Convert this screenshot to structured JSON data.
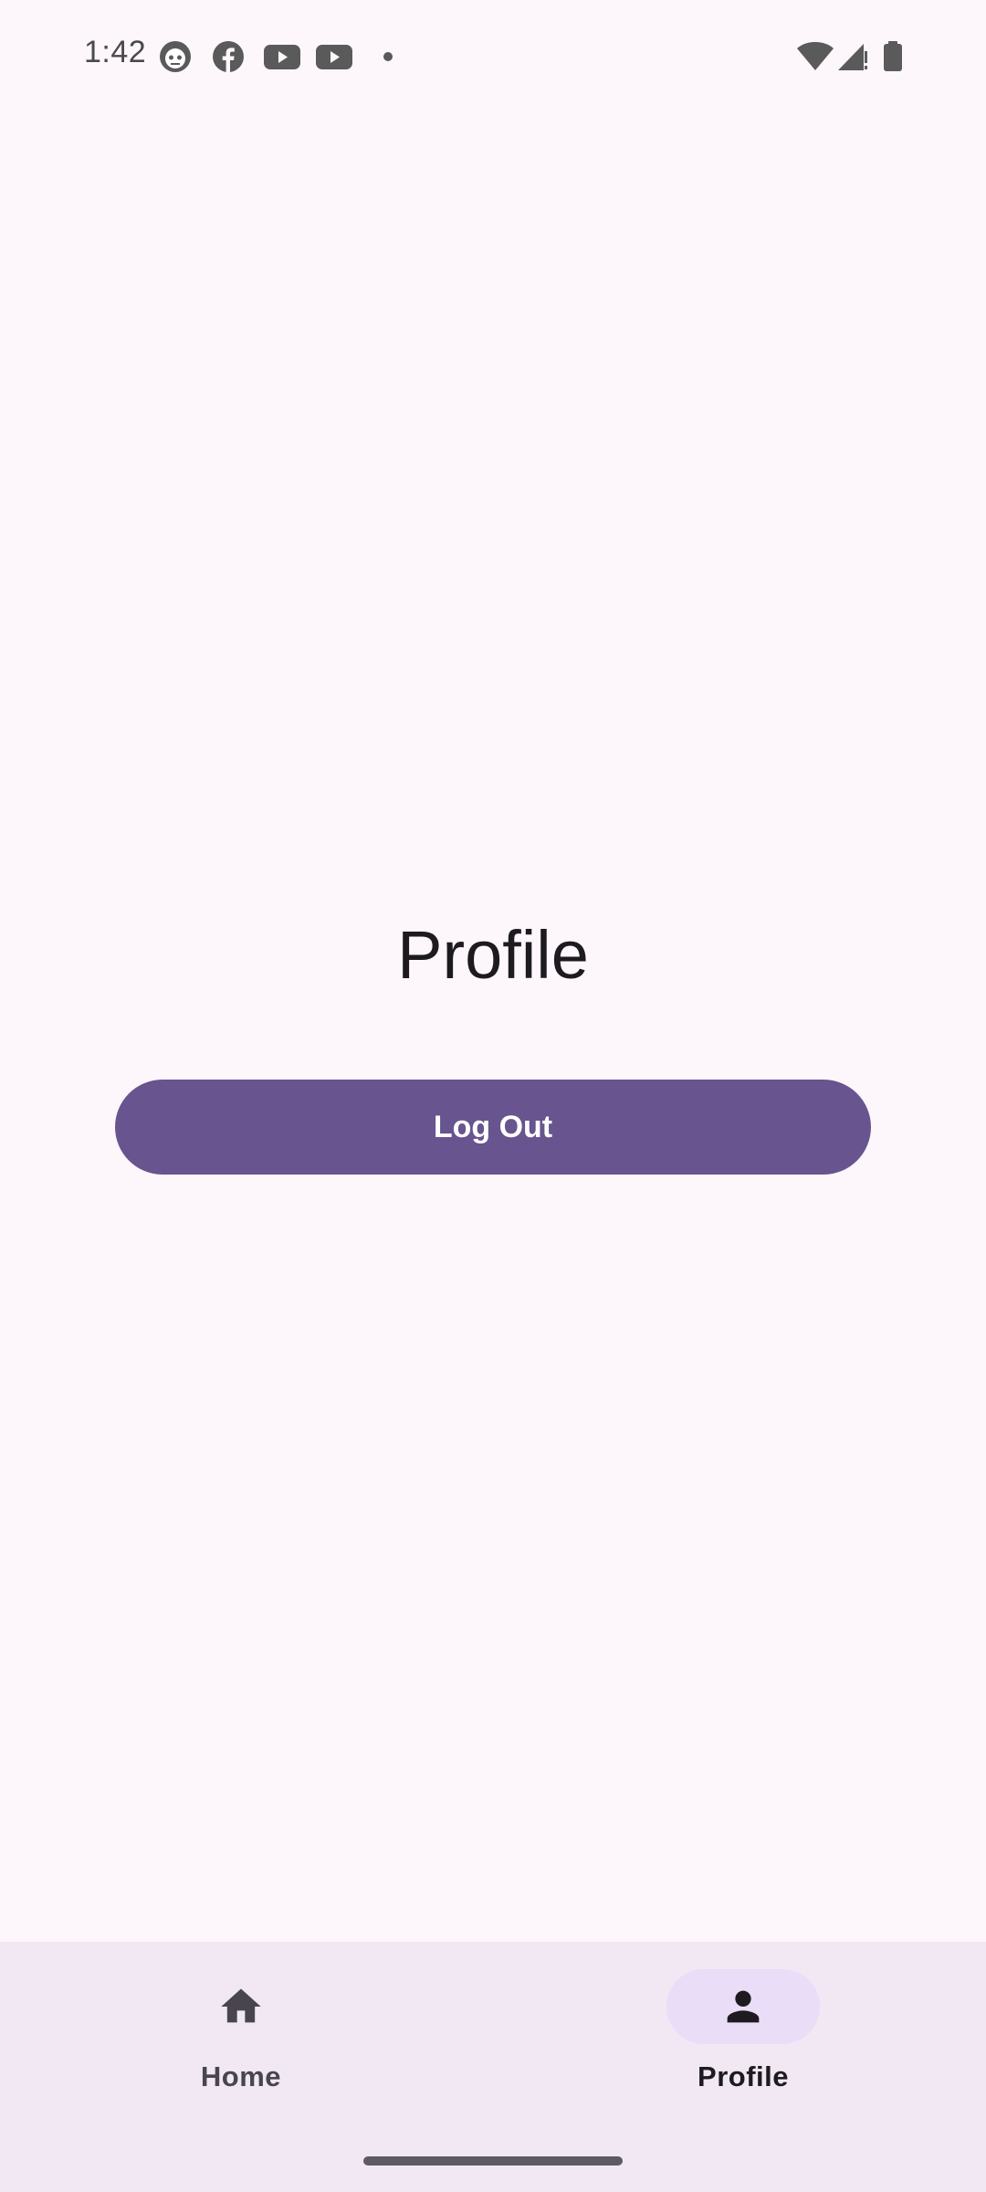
{
  "status_bar": {
    "time": "1:42",
    "notification_icons": [
      "robot-face-icon",
      "facebook-icon",
      "youtube-icon",
      "youtube-icon",
      "more-dot-icon"
    ],
    "system_icons": [
      "wifi-icon",
      "cellular-signal-icon",
      "battery-icon"
    ]
  },
  "main": {
    "title": "Profile",
    "logout_label": "Log Out"
  },
  "bottom_nav": {
    "items": [
      {
        "label": "Home",
        "icon": "home-icon",
        "selected": false
      },
      {
        "label": "Profile",
        "icon": "person-icon",
        "selected": true
      }
    ]
  },
  "colors": {
    "background": "#FDF7FC",
    "primary": "#68548E",
    "nav_background": "#F1E8F4",
    "nav_indicator": "#E9DDF7",
    "text": "#1D1B20"
  }
}
